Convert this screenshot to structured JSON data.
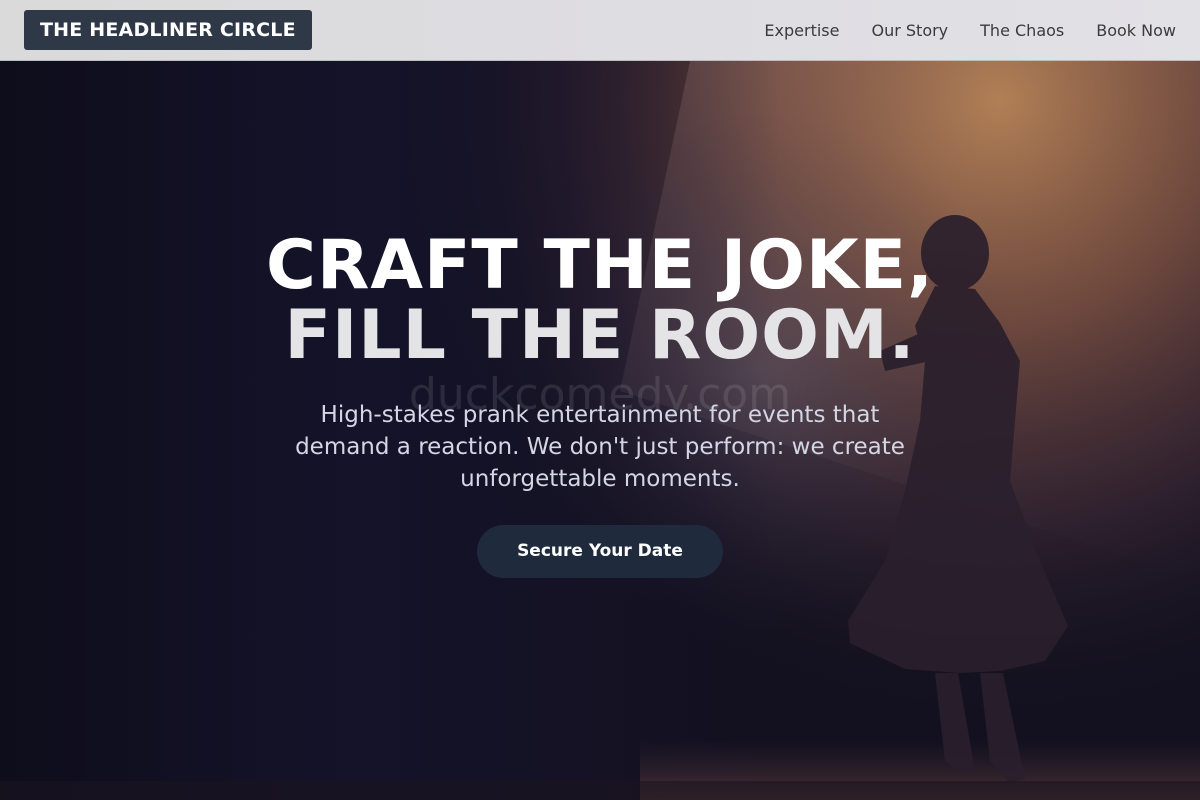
{
  "header": {
    "logo_text": "THE HEADLINER CIRCLE",
    "nav": [
      {
        "label": "Expertise"
      },
      {
        "label": "Our Story"
      },
      {
        "label": "The Chaos"
      },
      {
        "label": "Book Now"
      }
    ]
  },
  "hero": {
    "title_line1": "CRAFT THE JOKE,",
    "title_line2": "FILL THE ROOM.",
    "watermark": "duckcomedy.com",
    "subtitle": "High-stakes prank entertainment for events that demand a reaction. We don't just perform: we create unforgettable moments.",
    "cta_label": "Secure Your Date"
  },
  "colors": {
    "header_bg": "#dedde2",
    "logo_bg": "#2f3847",
    "hero_bg": "#13111f",
    "spotlight": "#c8864a",
    "cta_bg": "#1f2a3c"
  }
}
